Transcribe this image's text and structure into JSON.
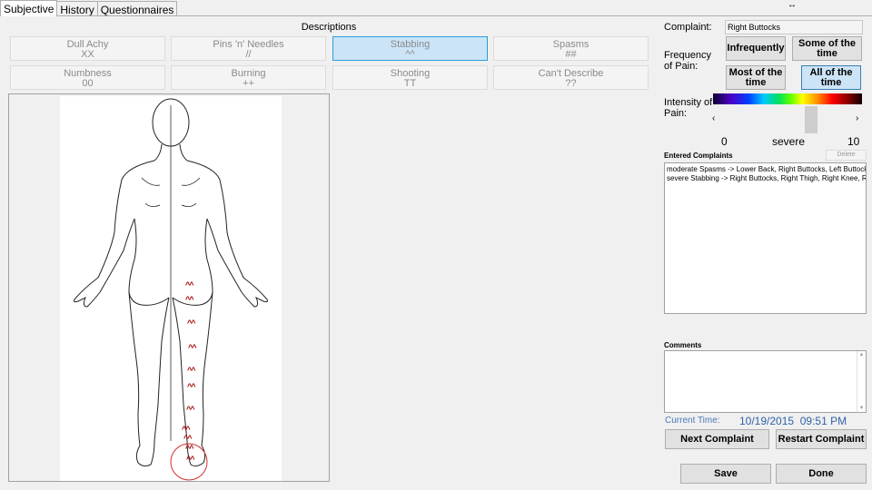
{
  "tabs": [
    "Subjective",
    "History",
    "Questionnaires"
  ],
  "resize_glyph": "↔",
  "descriptions": {
    "title": "Descriptions",
    "buttons": [
      {
        "label": "Dull Achy",
        "symbol": "XX"
      },
      {
        "label": "Pins 'n' Needles",
        "symbol": "//"
      },
      {
        "label": "Stabbing",
        "symbol": "^^"
      },
      {
        "label": "Spasms",
        "symbol": "##"
      },
      {
        "label": "Numbness",
        "symbol": "00"
      },
      {
        "label": "Burning",
        "symbol": "++"
      },
      {
        "label": "Shooting",
        "symbol": "TT"
      },
      {
        "label": "Can't Describe",
        "symbol": "??"
      }
    ]
  },
  "body_marks": [
    "^^",
    "^^",
    "^^",
    "^^",
    "^^",
    "^^",
    "^^",
    "^^",
    "^^",
    "^^",
    "^^"
  ],
  "complaint": {
    "label": "Complaint:",
    "value": "Right Buttocks"
  },
  "frequency": {
    "label": "Frequency of Pain:",
    "options": [
      "Infrequently",
      "Some of the time",
      "Most of the time",
      "All of the time"
    ],
    "selected": "All of the time"
  },
  "intensity": {
    "label": "Intensity of Pain:",
    "left_arrow": "‹",
    "right_arrow": "›",
    "min": "0",
    "max": "10",
    "value_text": "severe",
    "level": 0.72
  },
  "entered_complaints": {
    "label": "Entered Complaints",
    "delete_label": "Delete",
    "items": [
      "moderate Spasms -> Lower Back, Right Buttocks, Left Buttocks",
      "severe Stabbing -> Right Buttocks, Right Thigh, Right Knee, Ri"
    ]
  },
  "comments": {
    "label": "Comments",
    "scroll_up": "▲",
    "scroll_down": "▼"
  },
  "current_time": {
    "label": "Current Time:",
    "value": "10/19/2015  09:51 PM"
  },
  "buttons": {
    "next_complaint": "Next Complaint",
    "restart_complaint": "Restart Complaint",
    "save": "Save",
    "done": "Done"
  }
}
